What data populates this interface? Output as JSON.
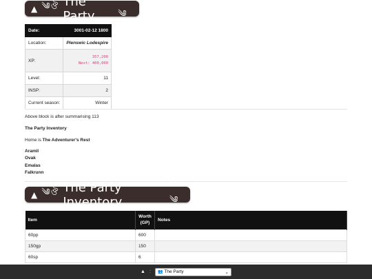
{
  "banner1": {
    "toggle": "▲",
    "ornament_left": "༄",
    "title": "The Party",
    "ornament_right": "༄"
  },
  "stats": {
    "date_label": "Date:",
    "date_value": "3001-02-12 1800",
    "location_label": "Location:",
    "location_value": "Plenswic Lodespire",
    "xp_label": "XP:",
    "xp_value": "357,200",
    "xp_next": "Next: 400,000",
    "level_label": "Level:",
    "level_value": "11",
    "insp_label": "INSP:",
    "insp_value": "2",
    "season_label": "Current season:",
    "season_value": "Winter"
  },
  "summary_note": "Above block is after summarising 113",
  "inventory_link": "The Party Inventory",
  "home": {
    "prefix": "Home is ",
    "place": "The Adventurer's Rest"
  },
  "members": [
    "Aramil",
    "Ovak",
    "Emalas",
    "Falkrunn"
  ],
  "banner2": {
    "toggle": "▲",
    "ornament_left": "༄",
    "title": "The Party Inventory",
    "ornament_right": "༄"
  },
  "inventory": {
    "headers": {
      "item": "Item",
      "worth_line1": "Worth",
      "worth_line2": "(GP)",
      "notes": "Notes"
    },
    "rows": [
      {
        "item": "60pp",
        "worth": "600",
        "notes": ""
      },
      {
        "item": "150gp",
        "worth": "150",
        "notes": ""
      },
      {
        "item": "60sp",
        "worth": "6",
        "notes": ""
      }
    ]
  },
  "bottombar": {
    "toggle": "▲",
    "separator": ":",
    "select_value": "The Party",
    "people_icon": "people-icon"
  }
}
